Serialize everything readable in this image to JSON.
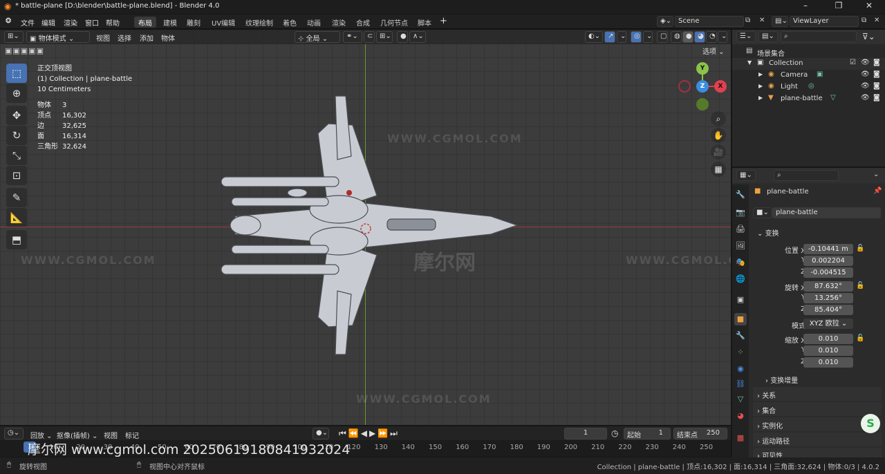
{
  "window": {
    "title": "* battle-plane [D:\\blender\\battle-plane.blend] - Blender 4.0"
  },
  "menu": {
    "items": [
      "文件",
      "编辑",
      "渲染",
      "窗口",
      "帮助"
    ]
  },
  "workspaces": [
    "布局",
    "建模",
    "雕刻",
    "UV编辑",
    "纹理绘制",
    "着色",
    "动画",
    "渲染",
    "合成",
    "几何节点",
    "脚本"
  ],
  "scene": {
    "name": "Scene",
    "view_layer": "ViewLayer"
  },
  "viewport": {
    "mode": "物体模式",
    "menus": [
      "视图",
      "选择",
      "添加",
      "物体"
    ],
    "orientation": "全局",
    "options_label": "选项",
    "view_name": "正交顶视图",
    "collection_info": "(1) Collection | plane-battle",
    "scale_info": "10 Centimeters",
    "stats": [
      {
        "k": "物体",
        "v": "3"
      },
      {
        "k": "顶点",
        "v": "16,302"
      },
      {
        "k": "边",
        "v": "32,625"
      },
      {
        "k": "面",
        "v": "16,314"
      },
      {
        "k": "三角形",
        "v": "32,624"
      }
    ],
    "gizmo": {
      "x": "X",
      "y": "Y",
      "z": "Z"
    },
    "watermark_text": "WWW.CGMOL.COM",
    "watermark_logo": "摩尔网"
  },
  "outliner": {
    "root": "场景集合",
    "collection": "Collection",
    "items": [
      "Camera",
      "Light",
      "plane-battle"
    ]
  },
  "properties": {
    "object_name": "plane-battle",
    "data_name": "plane-battle",
    "transform_title": "变换",
    "location_label": "位置 X",
    "location": [
      "-0.10441 m",
      "0.002204",
      "-0.004515"
    ],
    "rotation_label": "旋转 X",
    "rotation": [
      "87.632°",
      "13.256°",
      "85.404°"
    ],
    "mode_label": "模式",
    "mode_value": "XYZ 欧拉",
    "scale_label": "缩放 X",
    "scale": [
      "0.010",
      "0.010",
      "0.010"
    ],
    "axis_y": "Y",
    "axis_z": "Z",
    "delta": "变换增量",
    "sections": [
      "关系",
      "集合",
      "实例化",
      "运动路径",
      "可见性"
    ]
  },
  "timeline": {
    "menus": [
      "回放",
      "抠像(插帧)",
      "视图",
      "标记"
    ],
    "current_frame": "1",
    "start_label": "起始",
    "start": "1",
    "end_label": "结束点",
    "end": "250",
    "ticks": [
      "10",
      "20",
      "30",
      "40",
      "50",
      "60",
      "70",
      "80",
      "90",
      "100",
      "110",
      "120",
      "130",
      "140",
      "150",
      "160",
      "170",
      "180",
      "190",
      "200",
      "210",
      "220",
      "230",
      "240",
      "250"
    ],
    "overlay": "摩尔网 www.cgmol.com 20250619180841932024"
  },
  "statusbar": {
    "left": "旋转视图",
    "middle": "视图中心对齐鼠标",
    "right": "Collection | plane-battle | 顶点:16,302 | 面:16,314 | 三角面:32,624 | 物体:0/3 | 4.0.2"
  }
}
